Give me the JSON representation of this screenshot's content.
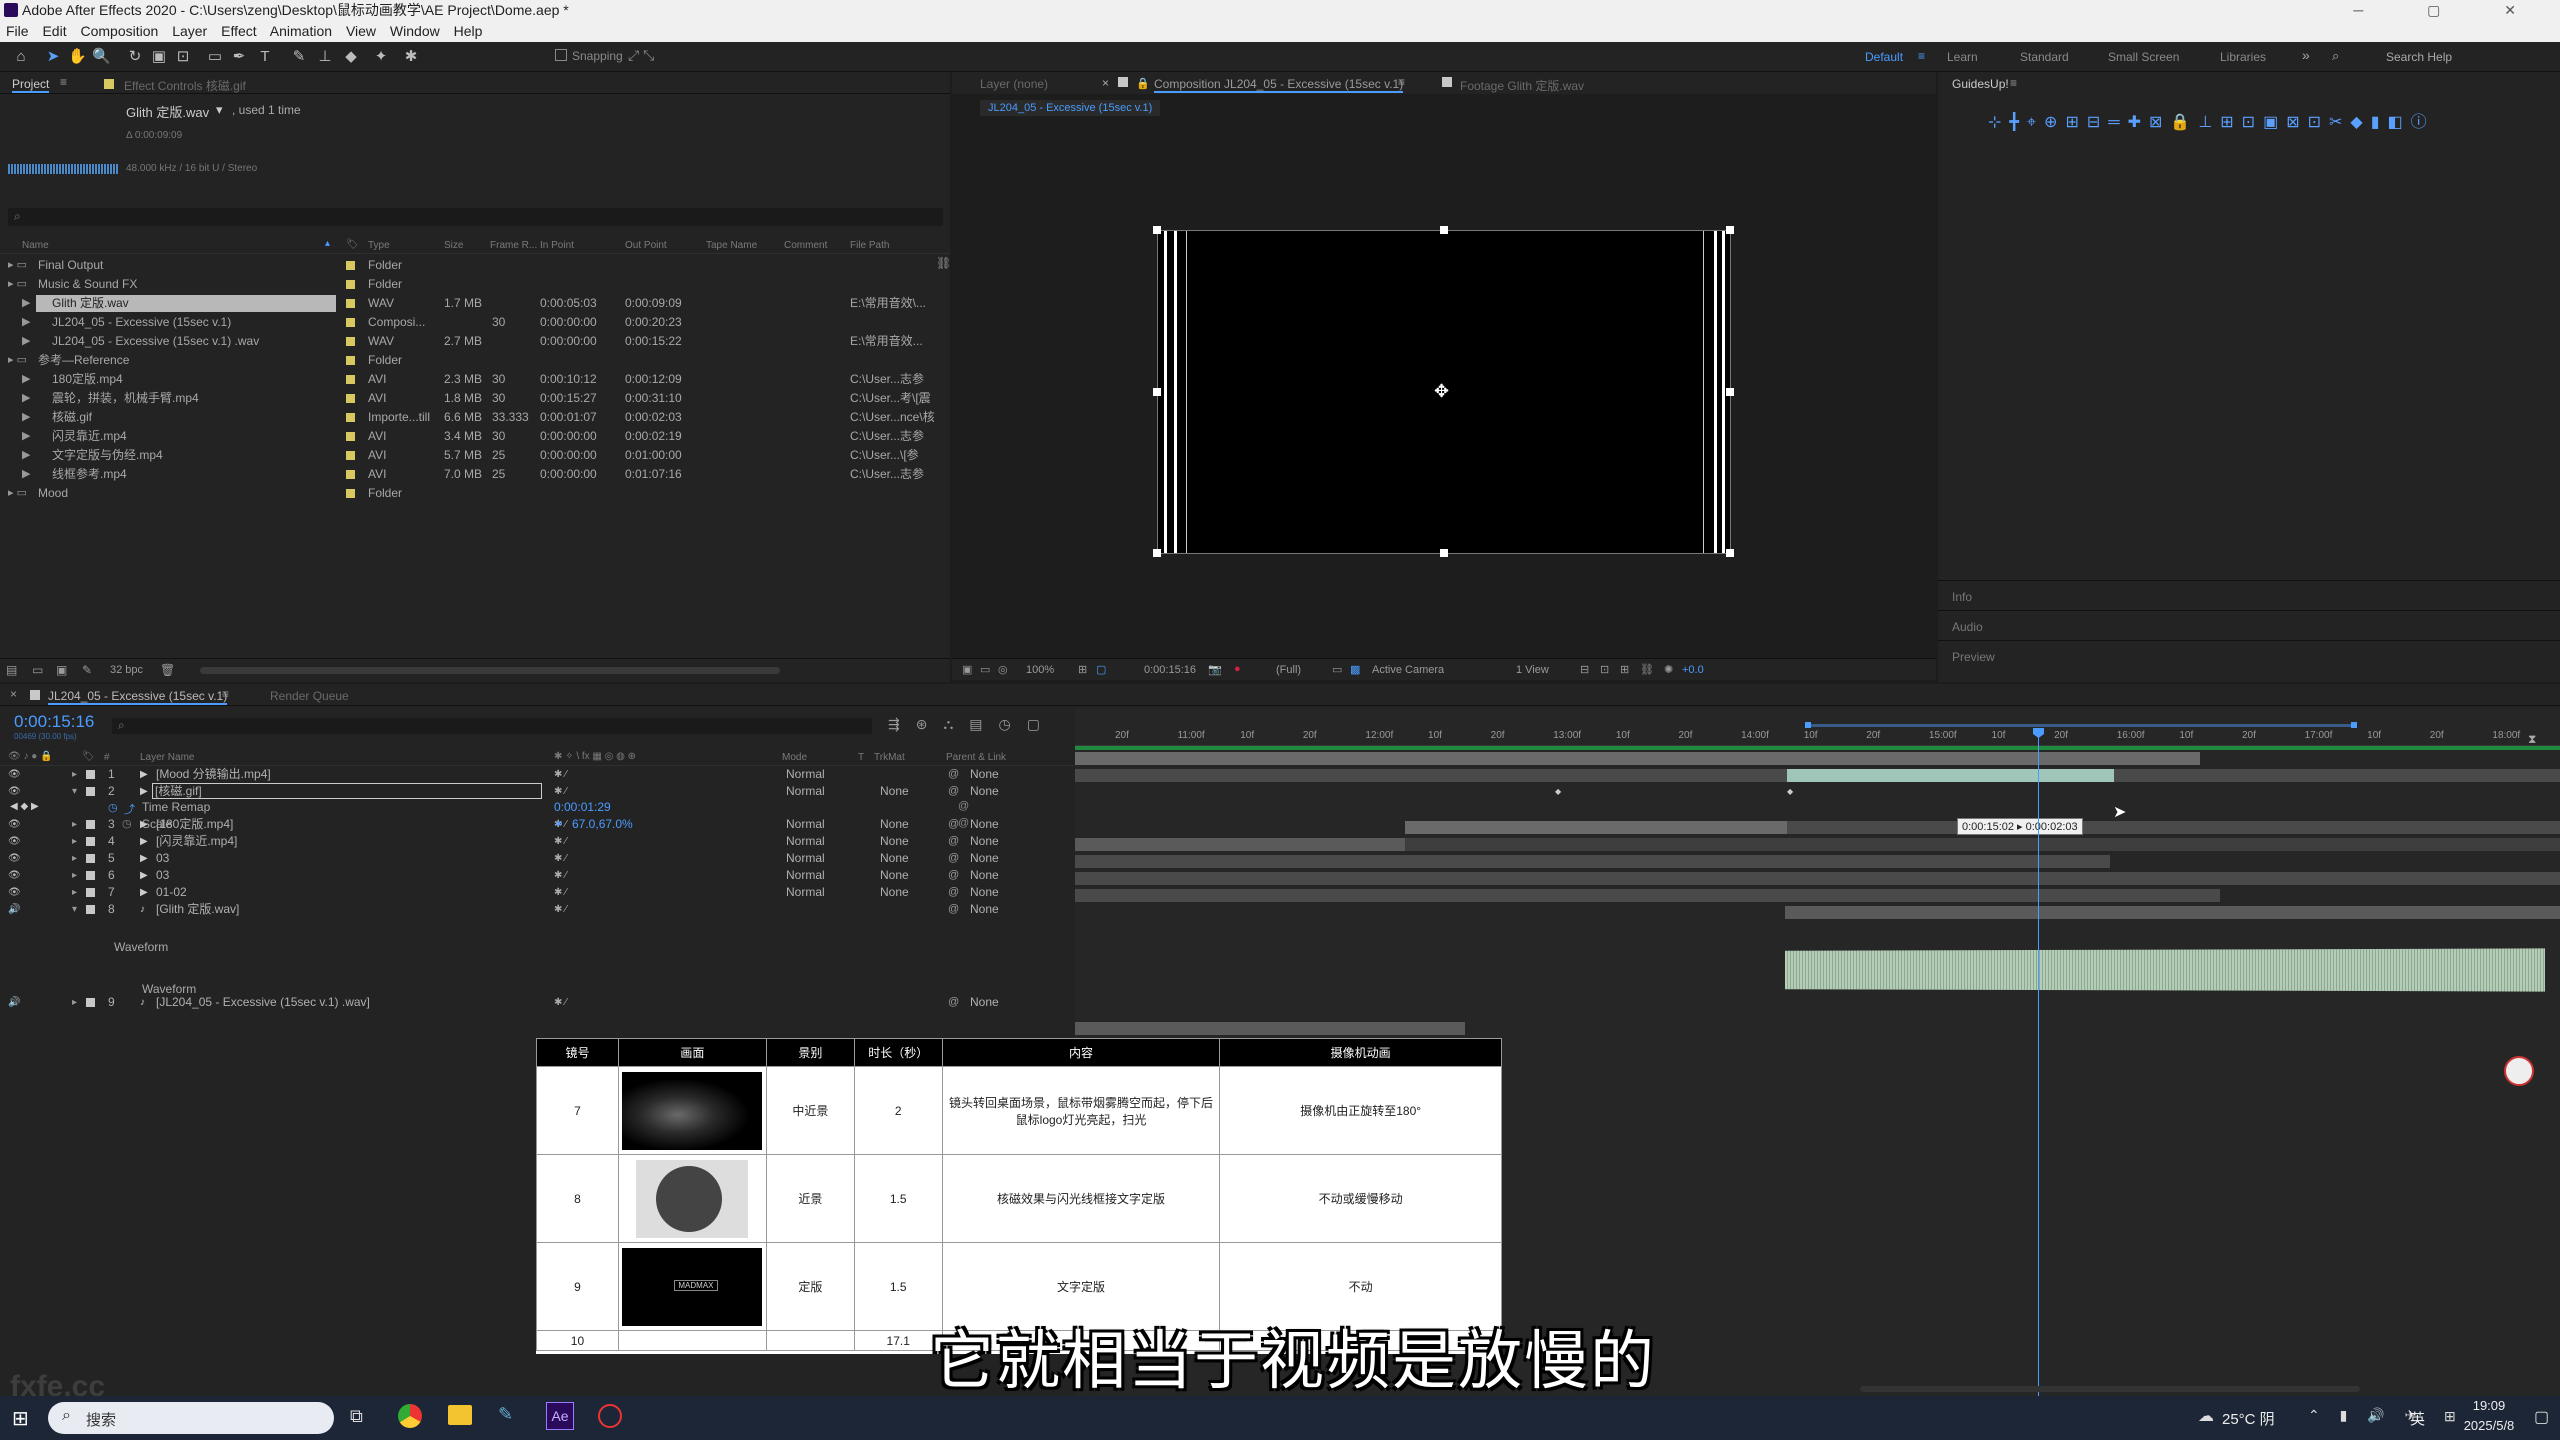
{
  "window": {
    "title": "Adobe After Effects 2020 - C:\\Users\\zeng\\Desktop\\鼠标动画教学\\AE Project\\Dome.aep *"
  },
  "menu": [
    "File",
    "Edit",
    "Composition",
    "Layer",
    "Effect",
    "Animation",
    "View",
    "Window",
    "Help"
  ],
  "toolbar": {
    "snapping_label": "Snapping"
  },
  "workspaces": {
    "items": [
      "Default",
      "Learn",
      "Standard",
      "Small Screen",
      "Libraries"
    ],
    "search": "Search Help"
  },
  "project": {
    "tab_label": "Project",
    "effect_controls_tab": "Effect Controls 核磁.gif",
    "footage_name": "Glith 定版.wav",
    "footage_used": ", used 1 time",
    "footage_duration": "Δ 0:00:09:09",
    "audio_info": "48.000 kHz / 16 bit U / Stereo",
    "search_placeholder": "",
    "columns": [
      "Name",
      "Type",
      "Size",
      "Frame R...",
      "In Point",
      "Out Point",
      "Tape Name",
      "Comment",
      "File Path"
    ],
    "rows": [
      {
        "name": "Final Output",
        "type": "Folder",
        "size": "",
        "fr": "",
        "in": "",
        "out": "",
        "path": ""
      },
      {
        "name": "Music & Sound FX",
        "type": "Folder",
        "size": "",
        "fr": "",
        "in": "",
        "out": "",
        "path": ""
      },
      {
        "name": "Glith 定版.wav",
        "type": "WAV",
        "size": "1.7 MB",
        "fr": "",
        "in": "0:00:05:03",
        "out": "0:00:09:09",
        "path": "E:\\常用音效\\...",
        "selected": true
      },
      {
        "name": "JL204_05 - Excessive (15sec v.1)",
        "type": "Composi...",
        "size": "",
        "fr": "30",
        "in": "0:00:00:00",
        "out": "0:00:20:23",
        "path": ""
      },
      {
        "name": "JL204_05 - Excessive (15sec v.1) .wav",
        "type": "WAV",
        "size": "2.7 MB",
        "fr": "",
        "in": "0:00:00:00",
        "out": "0:00:15:22",
        "path": "E:\\常用音效..."
      },
      {
        "name": "参考—Reference",
        "type": "Folder",
        "size": "",
        "fr": "",
        "in": "",
        "out": "",
        "path": ""
      },
      {
        "name": "180定版.mp4",
        "type": "AVI",
        "size": "2.3 MB",
        "fr": "30",
        "in": "0:00:10:12",
        "out": "0:00:12:09",
        "path": "C:\\User...志参"
      },
      {
        "name": "震轮，拼装，机械手臂.mp4",
        "type": "AVI",
        "size": "1.8 MB",
        "fr": "30",
        "in": "0:00:15:27",
        "out": "0:00:31:10",
        "path": "C:\\User...考\\[震"
      },
      {
        "name": "核磁.gif",
        "type": "Importe...till",
        "size": "6.6 MB",
        "fr": "33.333",
        "in": "0:00:01:07",
        "out": "0:00:02:03",
        "path": "C:\\User...nce\\核"
      },
      {
        "name": "闪灵靠近.mp4",
        "type": "AVI",
        "size": "3.4 MB",
        "fr": "30",
        "in": "0:00:00:00",
        "out": "0:00:02:19",
        "path": "C:\\User...志参"
      },
      {
        "name": "文字定版与伪经.mp4",
        "type": "AVI",
        "size": "5.7 MB",
        "fr": "25",
        "in": "0:00:00:00",
        "out": "0:01:00:00",
        "path": "C:\\User...\\[参"
      },
      {
        "name": "线框参考.mp4",
        "type": "AVI",
        "size": "7.0 MB",
        "fr": "25",
        "in": "0:00:00:00",
        "out": "0:01:07:16",
        "path": "C:\\User...志参"
      },
      {
        "name": "Mood",
        "type": "Folder",
        "size": "",
        "fr": "",
        "in": "",
        "out": "",
        "path": ""
      }
    ],
    "bpc": "32 bpc"
  },
  "viewer": {
    "layer_tab": "Layer (none)",
    "comp_tab": "Composition JL204_05 - Excessive (15sec v.1)",
    "footage_tab": "Footage Glith 定版.wav",
    "comp_chip": "JL204_05 - Excessive (15sec v.1)",
    "zoom": "100%",
    "timecode": "0:00:15:16",
    "resolution": "(Full)",
    "camera": "Active Camera",
    "views": "1 View",
    "exposure": "+0.0"
  },
  "right": {
    "guides_tab": "GuidesUp!",
    "info": "Info",
    "audio": "Audio",
    "preview": "Preview"
  },
  "timeline": {
    "comp_tab": "JL204_05 - Excessive (15sec v.1)",
    "render_tab": "Render Queue",
    "current_time": "0:00:15:16",
    "fps_note": "00469 (30.00 fps)",
    "col_layer_name": "Layer Name",
    "col_mode": "Mode",
    "col_trkmat": "TrkMat",
    "col_parent": "Parent & Link",
    "layers": [
      {
        "num": "1",
        "name": "[Mood 分镜输出.mp4]",
        "mode": "Normal",
        "trk": "",
        "parent": "None"
      },
      {
        "num": "2",
        "name": "[核磁.gif]",
        "mode": "Normal",
        "trk": "None",
        "parent": "None"
      },
      {
        "num": "3",
        "name": "[180定版.mp4]",
        "mode": "Normal",
        "trk": "None",
        "parent": "None"
      },
      {
        "num": "4",
        "name": "[闪灵靠近.mp4]",
        "mode": "Normal",
        "trk": "None",
        "parent": "None"
      },
      {
        "num": "5",
        "name": "03",
        "mode": "Normal",
        "trk": "None",
        "parent": "None"
      },
      {
        "num": "6",
        "name": "03",
        "mode": "Normal",
        "trk": "None",
        "parent": "None"
      },
      {
        "num": "7",
        "name": "01-02",
        "mode": "Normal",
        "trk": "None",
        "parent": "None"
      },
      {
        "num": "8",
        "name": "[Glith 定版.wav]",
        "mode": "",
        "trk": "",
        "parent": "None"
      },
      {
        "num": "9",
        "name": "[JL204_05 - Excessive (15sec v.1) .wav]",
        "mode": "",
        "trk": "",
        "parent": "None"
      }
    ],
    "time_remap_label": "Time Remap",
    "time_remap_value": "0:00:01:29",
    "scale_label": "Scale",
    "scale_value": "67.0,67.0%",
    "waveform_label": "Waveform",
    "ruler": [
      "20f",
      "11:00f",
      "10f",
      "20f",
      "12:00f",
      "10f",
      "20f",
      "13:00f",
      "10f",
      "20f",
      "14:00f",
      "10f",
      "20f",
      "15:00f",
      "10f",
      "20f",
      "16:00f",
      "10f",
      "20f",
      "17:00f",
      "10f",
      "20f",
      "18:00f"
    ],
    "tooltip": "0:00:15:02 ▸ 0:00:02:03"
  },
  "storyboard": {
    "headers": [
      "镜号",
      "画面",
      "景别",
      "时长（秒）",
      "内容",
      "摄像机动画"
    ],
    "rows": [
      {
        "no": "7",
        "shot": "中近景",
        "dur": "2",
        "content": "镜头转回桌面场景，鼠标带烟雾腾空而起，停下后鼠标logo灯光亮起，扫光",
        "camera": "摄像机由正旋转至180°"
      },
      {
        "no": "8",
        "shot": "近景",
        "dur": "1.5",
        "content": "核磁效果与闪光线框接文字定版",
        "camera": "不动或缓慢移动"
      },
      {
        "no": "9",
        "shot": "定版",
        "dur": "1.5",
        "content": "文字定版",
        "camera": "不动"
      },
      {
        "no": "10",
        "shot": "",
        "dur": "17.1",
        "content": "",
        "camera": ""
      }
    ],
    "logo_text": "MADMAX"
  },
  "subtitle": "它就相当于视频是放慢的",
  "watermark": "fxfe.cc",
  "taskbar": {
    "search_placeholder": "搜索",
    "weather": "25°C 阴",
    "ime": "英",
    "time": "19:09",
    "date": "2025/5/8"
  }
}
